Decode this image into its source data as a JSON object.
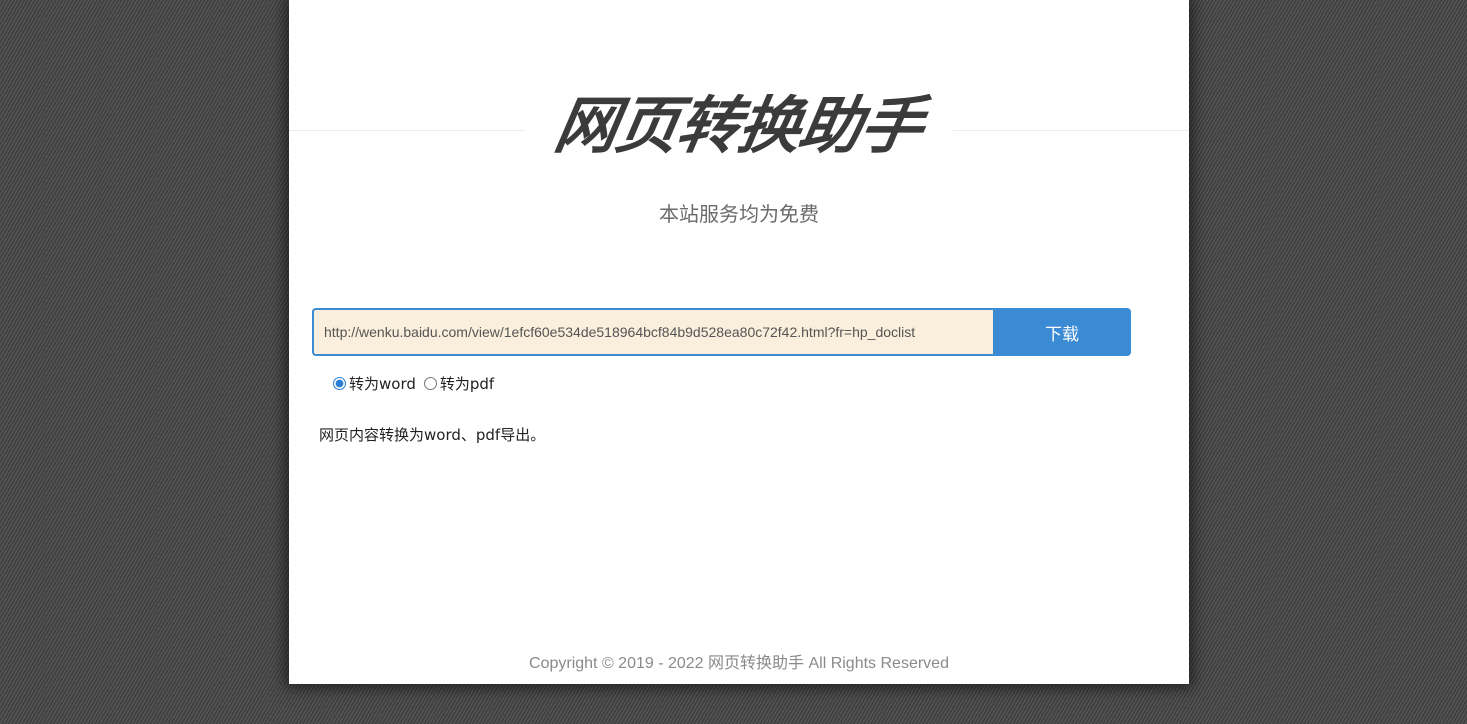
{
  "header": {
    "site_title": "网页转换助手",
    "subtitle": "本站服务均为免费"
  },
  "form": {
    "url_value": "http://wenku.baidu.com/view/1efcf60e534de518964bcf84b9d528ea80c72f42.html?fr=hp_doclist",
    "download_label": "下载",
    "options": [
      {
        "label": "转为word",
        "selected": true
      },
      {
        "label": "转为pdf",
        "selected": false
      }
    ]
  },
  "description": "网页内容转换为word、pdf导出。",
  "footer": {
    "copyright": "Copyright © 2019 - 2022 网页转换助手  All Rights Reserved"
  },
  "colors": {
    "accent": "#3a8ad4",
    "input_bg": "#faefdc",
    "title": "#3b3b3b"
  }
}
